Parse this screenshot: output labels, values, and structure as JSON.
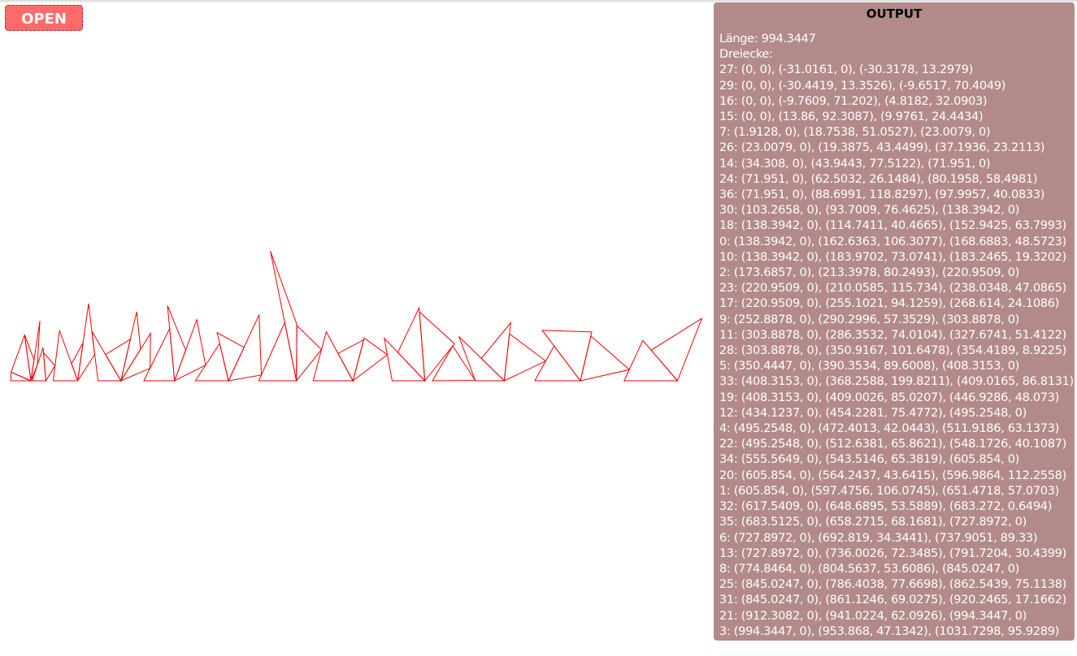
{
  "toolbar": {
    "open_label": "OPEN"
  },
  "colors": {
    "triangle_stroke": "#ff0000",
    "open_button_bg": "#ff6b6b",
    "output_panel_bg": "#b38a8a"
  },
  "output": {
    "title": "OUTPUT",
    "length_line": "Länge: 994.3447",
    "triangles_heading": "Dreiecke:",
    "triangles": [
      {
        "id": 27,
        "text": "27: (0, 0), (-31.0161, 0), (-30.3178, 13.2979)",
        "points": [
          [
            0,
            0
          ],
          [
            -31.0161,
            0
          ],
          [
            -30.3178,
            13.2979
          ]
        ]
      },
      {
        "id": 29,
        "text": "29: (0, 0), (-30.4419, 13.3526), (-9.6517, 70.4049)",
        "points": [
          [
            0,
            0
          ],
          [
            -30.4419,
            13.3526
          ],
          [
            -9.6517,
            70.4049
          ]
        ]
      },
      {
        "id": 16,
        "text": "16: (0, 0), (-9.7609, 71.202), (4.8182, 32.0903)",
        "points": [
          [
            0,
            0
          ],
          [
            -9.7609,
            71.202
          ],
          [
            4.8182,
            32.0903
          ]
        ]
      },
      {
        "id": 15,
        "text": "15: (0, 0), (13.86, 92.3087), (9.9761, 24.4434)",
        "points": [
          [
            0,
            0
          ],
          [
            13.86,
            92.3087
          ],
          [
            9.9761,
            24.4434
          ]
        ]
      },
      {
        "id": 7,
        "text": "7: (1.9128, 0), (18.7538, 51.0527), (23.0079, 0)",
        "points": [
          [
            1.9128,
            0
          ],
          [
            18.7538,
            51.0527
          ],
          [
            23.0079,
            0
          ]
        ]
      },
      {
        "id": 26,
        "text": "26: (23.0079, 0), (19.3875, 43.4499), (37.1936, 23.2113)",
        "points": [
          [
            23.0079,
            0
          ],
          [
            19.3875,
            43.4499
          ],
          [
            37.1936,
            23.2113
          ]
        ]
      },
      {
        "id": 14,
        "text": "14: (34.308, 0), (43.9443, 77.5122), (71.951, 0)",
        "points": [
          [
            34.308,
            0
          ],
          [
            43.9443,
            77.5122
          ],
          [
            71.951,
            0
          ]
        ]
      },
      {
        "id": 24,
        "text": "24: (71.951, 0), (62.5032, 26.1484), (80.1958, 58.4981)",
        "points": [
          [
            71.951,
            0
          ],
          [
            62.5032,
            26.1484
          ],
          [
            80.1958,
            58.4981
          ]
        ]
      },
      {
        "id": 36,
        "text": "36: (71.951, 0), (88.6991, 118.8297), (97.9957, 40.0833)",
        "points": [
          [
            71.951,
            0
          ],
          [
            88.6991,
            118.8297
          ],
          [
            97.9957,
            40.0833
          ]
        ]
      },
      {
        "id": 30,
        "text": "30: (103.2658, 0), (93.7009, 76.4625), (138.3942, 0)",
        "points": [
          [
            103.2658,
            0
          ],
          [
            93.7009,
            76.4625
          ],
          [
            138.3942,
            0
          ]
        ]
      },
      {
        "id": 18,
        "text": "18: (138.3942, 0), (114.7411, 40.4665), (152.9425, 63.7993)",
        "points": [
          [
            138.3942,
            0
          ],
          [
            114.7411,
            40.4665
          ],
          [
            152.9425,
            63.7993
          ]
        ]
      },
      {
        "id": 0,
        "text": "0: (138.3942, 0), (162.6363, 106.3077), (168.6883, 48.5723)",
        "points": [
          [
            138.3942,
            0
          ],
          [
            162.6363,
            106.3077
          ],
          [
            168.6883,
            48.5723
          ]
        ]
      },
      {
        "id": 10,
        "text": "10: (138.3942, 0), (183.9702, 73.0741), (183.2465, 19.3202)",
        "points": [
          [
            138.3942,
            0
          ],
          [
            183.9702,
            73.0741
          ],
          [
            183.2465,
            19.3202
          ]
        ]
      },
      {
        "id": 2,
        "text": "2: (173.6857, 0), (213.3978, 80.2493), (220.9509, 0)",
        "points": [
          [
            173.6857,
            0
          ],
          [
            213.3978,
            80.2493
          ],
          [
            220.9509,
            0
          ]
        ]
      },
      {
        "id": 23,
        "text": "23: (220.9509, 0), (210.0585, 115.734), (238.0348, 47.0865)",
        "points": [
          [
            220.9509,
            0
          ],
          [
            210.0585,
            115.734
          ],
          [
            238.0348,
            47.0865
          ]
        ]
      },
      {
        "id": 17,
        "text": "17: (220.9509, 0), (255.1021, 94.1259), (268.614, 24.1086)",
        "points": [
          [
            220.9509,
            0
          ],
          [
            255.1021,
            94.1259
          ],
          [
            268.614,
            24.1086
          ]
        ]
      },
      {
        "id": 9,
        "text": "9: (252.8878, 0), (290.2996, 57.3529), (303.8878, 0)",
        "points": [
          [
            252.8878,
            0
          ],
          [
            290.2996,
            57.3529
          ],
          [
            303.8878,
            0
          ]
        ]
      },
      {
        "id": 11,
        "text": "11: (303.8878, 0), (286.3532, 74.0104), (327.6741, 51.4122)",
        "points": [
          [
            303.8878,
            0
          ],
          [
            286.3532,
            74.0104
          ],
          [
            327.6741,
            51.4122
          ]
        ]
      },
      {
        "id": 28,
        "text": "28: (303.8878, 0), (350.9167, 101.6478), (354.4189, 8.9225)",
        "points": [
          [
            303.8878,
            0
          ],
          [
            350.9167,
            101.6478
          ],
          [
            354.4189,
            8.9225
          ]
        ]
      },
      {
        "id": 5,
        "text": "5: (350.4447, 0), (390.3534, 89.6008), (408.3153, 0)",
        "points": [
          [
            350.4447,
            0
          ],
          [
            390.3534,
            89.6008
          ],
          [
            408.3153,
            0
          ]
        ]
      },
      {
        "id": 33,
        "text": "33: (408.3153, 0), (368.2588, 199.8211), (409.0165, 86.8131)",
        "points": [
          [
            408.3153,
            0
          ],
          [
            368.2588,
            199.8211
          ],
          [
            409.0165,
            86.8131
          ]
        ]
      },
      {
        "id": 19,
        "text": "19: (408.3153, 0), (409.0026, 85.0207), (446.9286, 48.073)",
        "points": [
          [
            408.3153,
            0
          ],
          [
            409.0026,
            85.0207
          ],
          [
            446.9286,
            48.073
          ]
        ]
      },
      {
        "id": 12,
        "text": "12: (434.1237, 0), (454.2281, 75.4772), (495.2548, 0)",
        "points": [
          [
            434.1237,
            0
          ],
          [
            454.2281,
            75.4772
          ],
          [
            495.2548,
            0
          ]
        ]
      },
      {
        "id": 4,
        "text": "4: (495.2548, 0), (472.4013, 42.0443), (511.9186, 63.1373)",
        "points": [
          [
            495.2548,
            0
          ],
          [
            472.4013,
            42.0443
          ],
          [
            511.9186,
            63.1373
          ]
        ]
      },
      {
        "id": 22,
        "text": "22: (495.2548, 0), (512.6381, 65.8621), (548.1726, 40.1087)",
        "points": [
          [
            495.2548,
            0
          ],
          [
            512.6381,
            65.8621
          ],
          [
            548.1726,
            40.1087
          ]
        ]
      },
      {
        "id": 34,
        "text": "34: (555.5649, 0), (543.5146, 65.3819), (605.854, 0)",
        "points": [
          [
            555.5649,
            0
          ],
          [
            543.5146,
            65.3819
          ],
          [
            605.854,
            0
          ]
        ]
      },
      {
        "id": 20,
        "text": "20: (605.854, 0), (564.2437, 43.6415), (596.9864, 112.2558)",
        "points": [
          [
            605.854,
            0
          ],
          [
            564.2437,
            43.6415
          ],
          [
            596.9864,
            112.2558
          ]
        ]
      },
      {
        "id": 1,
        "text": "1: (605.854, 0), (597.4756, 106.0745), (651.4718, 57.0703)",
        "points": [
          [
            605.854,
            0
          ],
          [
            597.4756,
            106.0745
          ],
          [
            651.4718,
            57.0703
          ]
        ]
      },
      {
        "id": 32,
        "text": "32: (617.5409, 0), (648.6895, 53.5889), (683.272, 0.6494)",
        "points": [
          [
            617.5409,
            0
          ],
          [
            648.6895,
            53.5889
          ],
          [
            683.272,
            0.6494
          ]
        ]
      },
      {
        "id": 35,
        "text": "35: (683.5125, 0), (658.2715, 68.1681), (727.8972, 0)",
        "points": [
          [
            683.5125,
            0
          ],
          [
            658.2715,
            68.1681
          ],
          [
            727.8972,
            0
          ]
        ]
      },
      {
        "id": 6,
        "text": "6: (727.8972, 0), (692.819, 34.3441), (737.9051, 89.33)",
        "points": [
          [
            727.8972,
            0
          ],
          [
            692.819,
            34.3441
          ],
          [
            737.9051,
            89.33
          ]
        ]
      },
      {
        "id": 13,
        "text": "13: (727.8972, 0), (736.0026, 72.3485), (791.7204, 30.4399)",
        "points": [
          [
            727.8972,
            0
          ],
          [
            736.0026,
            72.3485
          ],
          [
            791.7204,
            30.4399
          ]
        ]
      },
      {
        "id": 8,
        "text": "8: (774.8464, 0), (804.5637, 53.6086), (845.0247, 0)",
        "points": [
          [
            774.8464,
            0
          ],
          [
            804.5637,
            53.6086
          ],
          [
            845.0247,
            0
          ]
        ]
      },
      {
        "id": 25,
        "text": "25: (845.0247, 0), (786.4038, 77.6698), (862.5439, 75.1138)",
        "points": [
          [
            845.0247,
            0
          ],
          [
            786.4038,
            77.6698
          ],
          [
            862.5439,
            75.1138
          ]
        ]
      },
      {
        "id": 31,
        "text": "31: (845.0247, 0), (861.1246, 69.0275), (920.2465, 17.1662)",
        "points": [
          [
            845.0247,
            0
          ],
          [
            861.1246,
            69.0275
          ],
          [
            920.2465,
            17.1662
          ]
        ]
      },
      {
        "id": 21,
        "text": "21: (912.3082, 0), (941.0224, 62.0926), (994.3447, 0)",
        "points": [
          [
            912.3082,
            0
          ],
          [
            941.0224,
            62.0926
          ],
          [
            994.3447,
            0
          ]
        ]
      },
      {
        "id": 3,
        "text": "3: (994.3447, 0), (953.868, 47.1342), (1031.7298, 95.9289)",
        "points": [
          [
            994.3447,
            0
          ],
          [
            953.868,
            47.1342
          ],
          [
            1031.7298,
            95.9289
          ]
        ]
      }
    ]
  }
}
